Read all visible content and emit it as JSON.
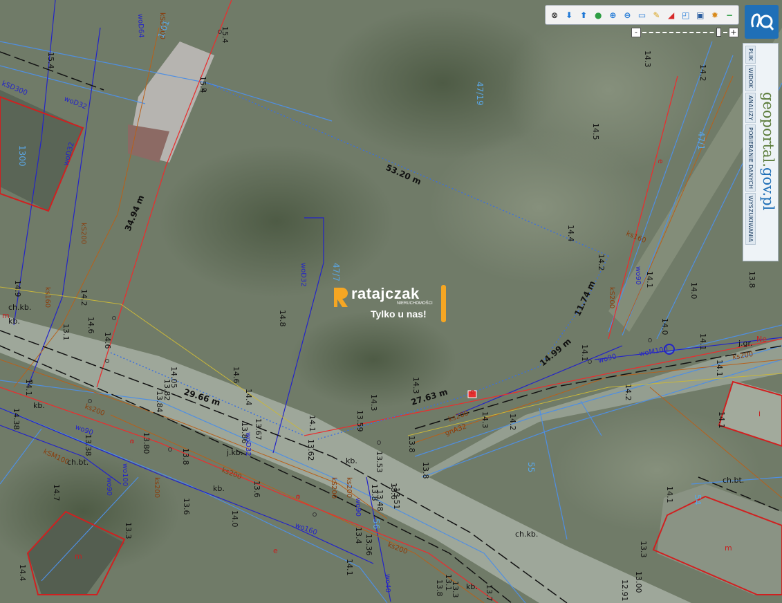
{
  "toolbar": {
    "tools": [
      {
        "name": "pan-tool",
        "glyph": "⊗",
        "color": "#333333"
      },
      {
        "name": "arrow-down-icon",
        "glyph": "⬇",
        "color": "#1e78d6"
      },
      {
        "name": "arrow-up-icon",
        "glyph": "⬆",
        "color": "#1e78d6"
      },
      {
        "name": "globe-icon",
        "glyph": "●",
        "color": "#2f9e44"
      },
      {
        "name": "zoom-in-icon",
        "glyph": "⊕",
        "color": "#1e78d6"
      },
      {
        "name": "zoom-out-icon",
        "glyph": "⊖",
        "color": "#1e78d6"
      },
      {
        "name": "scale-icon",
        "glyph": "▭",
        "color": "#1e78d6"
      },
      {
        "name": "measure-pencil-icon",
        "glyph": "✎",
        "color": "#d9a21b"
      },
      {
        "name": "measure-area-icon",
        "glyph": "◢",
        "color": "#d62828"
      },
      {
        "name": "info-icon",
        "glyph": "◰",
        "color": "#1e78d6"
      },
      {
        "name": "print-icon",
        "glyph": "▣",
        "color": "#2a5d9f"
      },
      {
        "name": "settings-icon",
        "glyph": "✹",
        "color": "#d98a1b"
      },
      {
        "name": "close-icon",
        "glyph": "−",
        "color": "#2f9e44"
      }
    ]
  },
  "zoom": {
    "minus": "-",
    "plus": "+",
    "level": 0.92
  },
  "menu": {
    "tabs": [
      "PLIK",
      "WIDOK",
      "ANALIZY",
      "POBIERANIE DANYCH",
      "WYSZUKIWANIA"
    ],
    "brand_main": "geoportal.",
    "brand_tld": "gov.pl"
  },
  "watermark": {
    "name": "ratajczak",
    "sub": "NIERUCHOMOŚCI",
    "tag": "Tylko u nas!"
  },
  "map": {
    "measurements": [
      "53.20 m",
      "34.94 m",
      "11.74 m",
      "14.99 m",
      "27.63 m",
      "29.66 m"
    ],
    "elevations": [
      "15.4",
      "15.4",
      "15.4",
      "14.3",
      "14.2",
      "14.5",
      "14.4",
      "14.2",
      "14.1",
      "13.8",
      "14.0",
      "14.0",
      "14.1",
      "14.1",
      "14.2",
      "14.1",
      "14.1",
      "14.9",
      "14.2",
      "14.6",
      "14.6",
      "13.1",
      "14.8",
      "14.6",
      "14.05",
      "13.82",
      "13.84",
      "14.4",
      "14.3",
      "14.3",
      "14.3",
      "14.2",
      "14.1",
      "13.59",
      "13.67",
      "13.86",
      "13.62",
      "13.80",
      "13.8",
      "13.8",
      "13.6",
      "14.1",
      "14.38",
      "13.38",
      "13.8",
      "13.3",
      "14.7",
      "13.6",
      "14.0",
      "13.53",
      "13.8",
      "13.6",
      "13.7",
      "13.48",
      "13.51",
      "13.4",
      "13.36",
      "14.1",
      "13.3",
      "14.1",
      "13.1",
      "13.00",
      "12.91",
      "14.4",
      "13.3",
      "13.8"
    ],
    "parcels": [
      "47/19",
      "47/1",
      "47/7",
      "1300",
      "56",
      "54",
      "55"
    ],
    "utility_labels": [
      "kSD300",
      "woD64",
      "kSD300",
      "woD32",
      "woD32",
      "wo90",
      "kS200",
      "ks160",
      "ks160",
      "kS200",
      "ks200",
      "ks200",
      "ks200",
      "wo160",
      "ks200",
      "wo90",
      "ks200",
      "wo90",
      "woM100",
      "woD32",
      "wo90",
      "wo100",
      "kS200",
      "gnA32",
      "kSM100",
      "ks200",
      "wo90",
      "woD32",
      "wo40",
      "ks200",
      "e",
      "e",
      "e",
      "e",
      "e",
      "Ne",
      "1.01"
    ],
    "building_marks": [
      "m",
      "m",
      "m",
      "i"
    ],
    "road_labels": [
      "ch.kb.",
      "kb.",
      "j.kb.",
      "kb.",
      "kb.",
      "kb.",
      "ch.kb.",
      "ch.bt.",
      "ch.bt.",
      "j.gr.",
      "kb."
    ]
  }
}
